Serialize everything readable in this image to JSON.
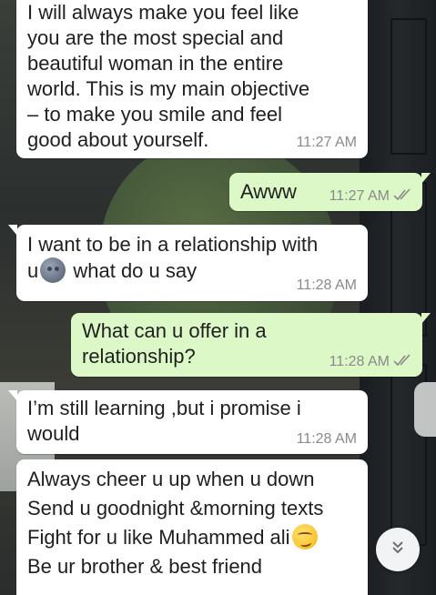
{
  "messages": [
    {
      "id": "m1",
      "direction": "incoming",
      "lines": [
        "I will always make you feel like",
        "you are the most special and",
        "beautiful woman in the entire",
        "world. This is my main objective",
        "– to make you smile and feel",
        "good about yourself."
      ],
      "time": "11:27 AM"
    },
    {
      "id": "m2",
      "direction": "outgoing",
      "text": "Awww",
      "time": "11:27 AM",
      "status": "read-double-tick"
    },
    {
      "id": "m3",
      "direction": "incoming",
      "line1": "I want to be in a relationship with",
      "line2_prefix": "u",
      "line2_emoji": "new-moon-face-emoji",
      "line2_suffix": " what do u say",
      "time": "11:28 AM"
    },
    {
      "id": "m4",
      "direction": "outgoing",
      "lines": [
        "What can u offer in a",
        "relationship?"
      ],
      "time": "11:28 AM",
      "status": "read-double-tick"
    },
    {
      "id": "m5",
      "direction": "incoming",
      "lines": [
        "I’m still learning ,but i promise i",
        "would"
      ],
      "time": "11:28 AM"
    },
    {
      "id": "m6",
      "direction": "incoming",
      "line1": "Always cheer u up when u down",
      "line2": "Send u goodnight &morning texts",
      "line3_text": "Fight for u like Muhammed ali",
      "line3_emoji": "smirking-face-emoji",
      "line4": "Be ur brother & best friend"
    }
  ],
  "scroll_button": {
    "icon": "double-chevron-down-icon"
  },
  "colors": {
    "incoming_bubble": "#ffffff",
    "outgoing_bubble": "#dcf8c6",
    "timestamp": "#8a8a8a",
    "read_tick": "#8a8a8a"
  }
}
